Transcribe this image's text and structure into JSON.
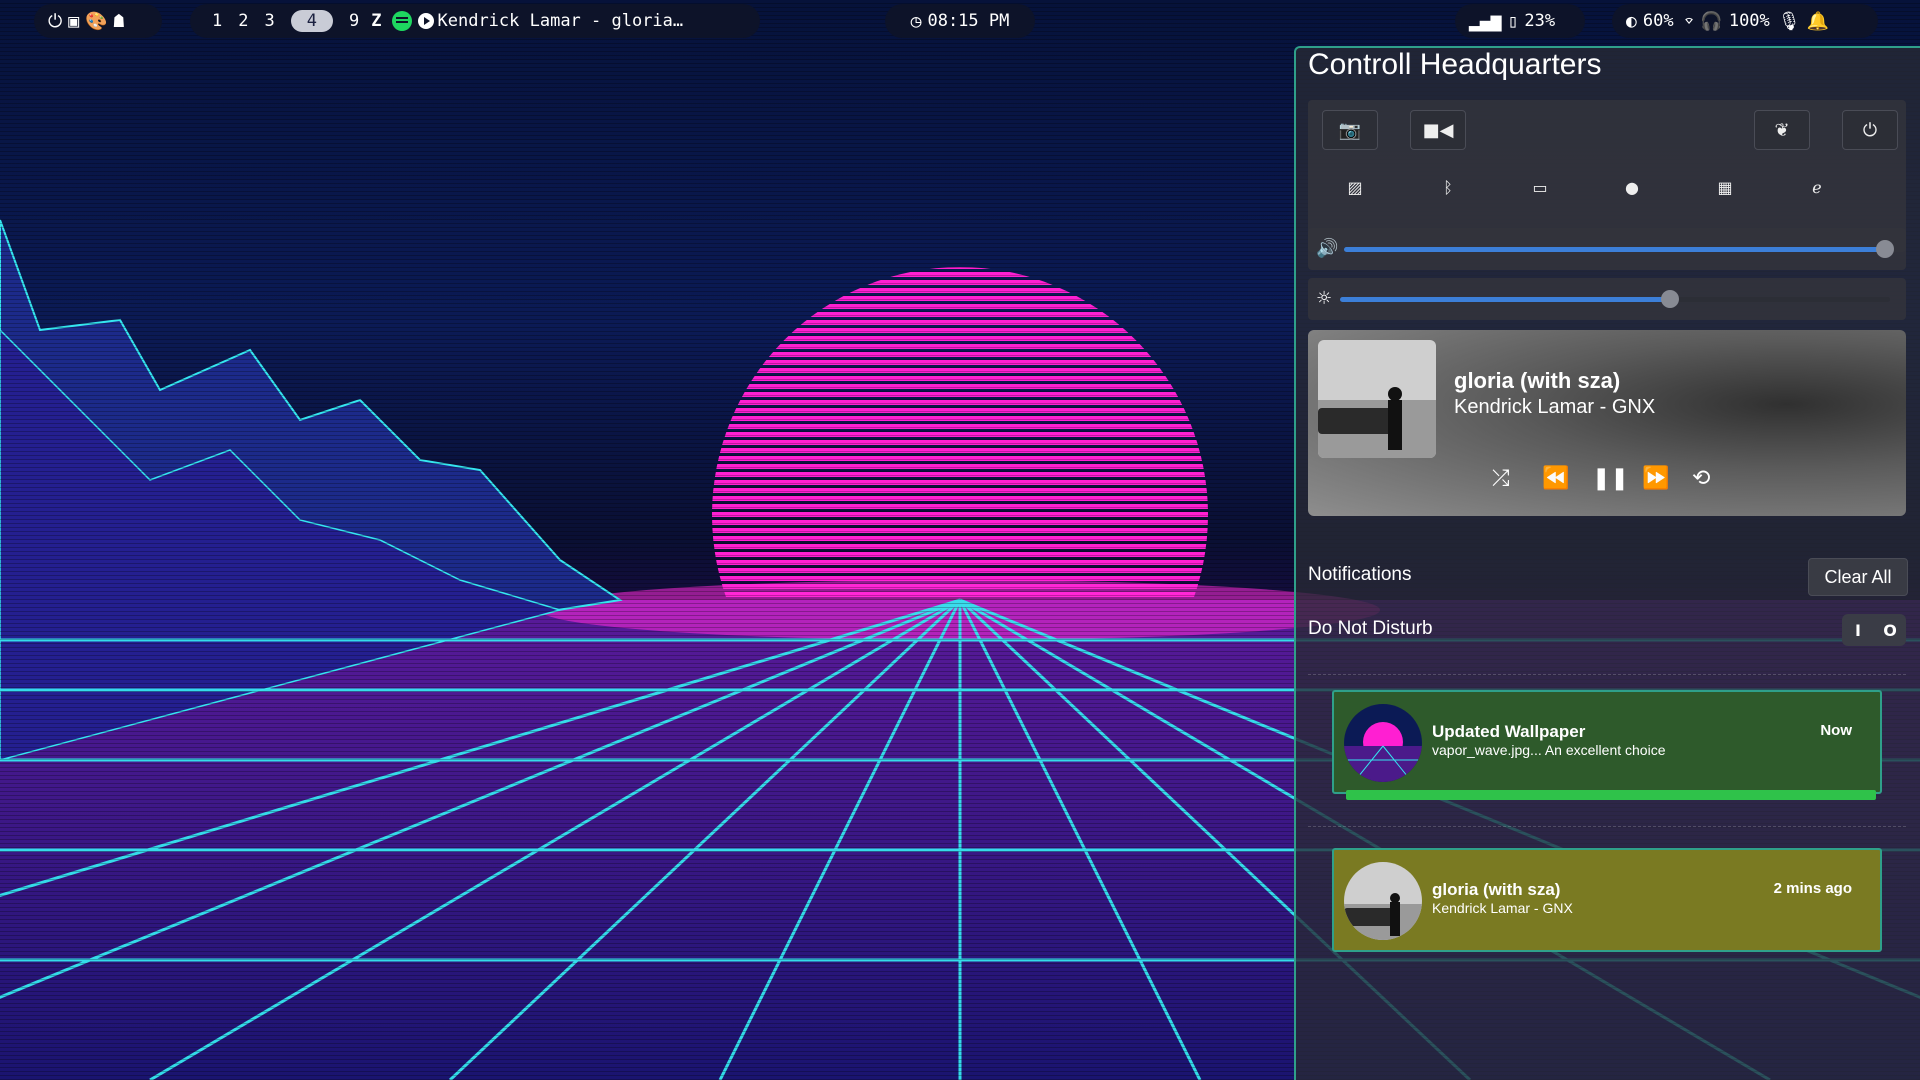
{
  "topbar": {
    "left_icons": [
      "power-icon",
      "windows-icon",
      "palette-icon",
      "ghost-icon"
    ],
    "workspaces": [
      "1",
      "2",
      "3",
      "4",
      "9"
    ],
    "active_workspace": "4",
    "now_playing": "Kendrick Lamar - gloria…",
    "clock": "08:15 PM",
    "signal_battery": "23%",
    "brightness": "60%",
    "headphones": "100%"
  },
  "panel": {
    "title": "Controll Headquarters",
    "volume_level": 0.99,
    "brightness_level": 0.6,
    "media": {
      "title": "gloria (with sza)",
      "subtitle": "Kendrick Lamar - GNX"
    },
    "notifications_label": "Notifications",
    "clear_all": "Clear All",
    "dnd_label": "Do Not Disturb",
    "dnd_on": "I",
    "dnd_off": "O",
    "notifications": [
      {
        "title": "Updated Wallpaper",
        "body": "vapor_wave.jpg... An excellent choice",
        "time": "Now",
        "color": "#2e5a2b"
      },
      {
        "title": "gloria (with sza)",
        "body": "Kendrick Lamar - GNX",
        "time": "2 mins ago",
        "color": "#7a7a22"
      }
    ]
  },
  "colors": {
    "sun": "#ff1fd2",
    "grid": "#35e6f0",
    "accent": "#2fa08a"
  }
}
